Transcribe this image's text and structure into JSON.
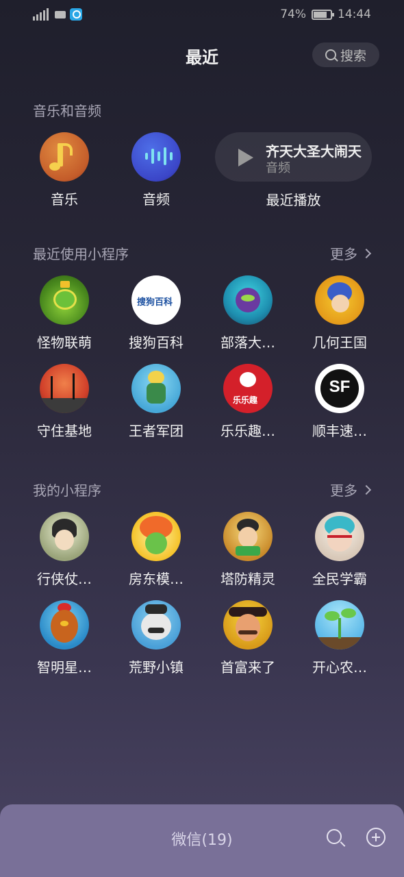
{
  "status_bar": {
    "battery": "74%",
    "time": "14:44"
  },
  "header": {
    "title": "最近",
    "search_label": "搜索"
  },
  "music_section": {
    "label": "音乐和音频",
    "items": [
      {
        "label": "音乐",
        "icon": "music-note-icon"
      },
      {
        "label": "音频",
        "icon": "audio-wave-icon"
      }
    ],
    "recent_play": {
      "title": "齐天大圣大闹天",
      "subtitle": "音频",
      "label": "最近播放"
    }
  },
  "recent_section": {
    "label": "最近使用小程序",
    "more": "更多",
    "apps": [
      {
        "label": "怪物联萌"
      },
      {
        "label": "搜狗百科",
        "logo_text": "搜狗百科"
      },
      {
        "label": "部落大…"
      },
      {
        "label": "几何王国"
      },
      {
        "label": "守住基地"
      },
      {
        "label": "王者军团"
      },
      {
        "label": "乐乐趣…",
        "logo_text": "乐乐趣"
      },
      {
        "label": "顺丰速…",
        "logo_text": "SF"
      }
    ]
  },
  "my_section": {
    "label": "我的小程序",
    "more": "更多",
    "apps": [
      {
        "label": "行侠仗…"
      },
      {
        "label": "房东模…"
      },
      {
        "label": "塔防精灵"
      },
      {
        "label": "全民学霸"
      },
      {
        "label": "智明星…"
      },
      {
        "label": "荒野小镇"
      },
      {
        "label": "首富来了"
      },
      {
        "label": "开心农…"
      }
    ]
  },
  "dock": {
    "title": "微信(19)"
  },
  "colors": {
    "background_top": "#1f1f2c",
    "background_bottom": "#4a4462",
    "dock": "#797098"
  }
}
